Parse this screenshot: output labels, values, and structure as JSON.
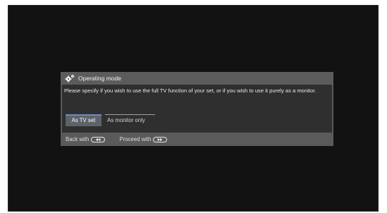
{
  "dialog": {
    "title": "Operating mode",
    "message": "Please specify if you wish to use the full TV function of your set, or if you wish to use it purely as a monitor.",
    "options": [
      {
        "label": "As TV set",
        "selected": true
      },
      {
        "label": "As monitor only",
        "selected": false
      }
    ],
    "footer": {
      "back_label": "Back with",
      "proceed_label": "Proceed with"
    }
  },
  "colors": {
    "screen_background": "#121212",
    "dialog_frame": "#5a5a5a",
    "dialog_body": "#2f2f2f",
    "selected_option": "#5d6368",
    "selected_accent": "#6a8dbd"
  },
  "icons": {
    "header": "gear-icon",
    "back_key": "rewind-key-icon",
    "proceed_key": "fast-forward-key-icon"
  }
}
